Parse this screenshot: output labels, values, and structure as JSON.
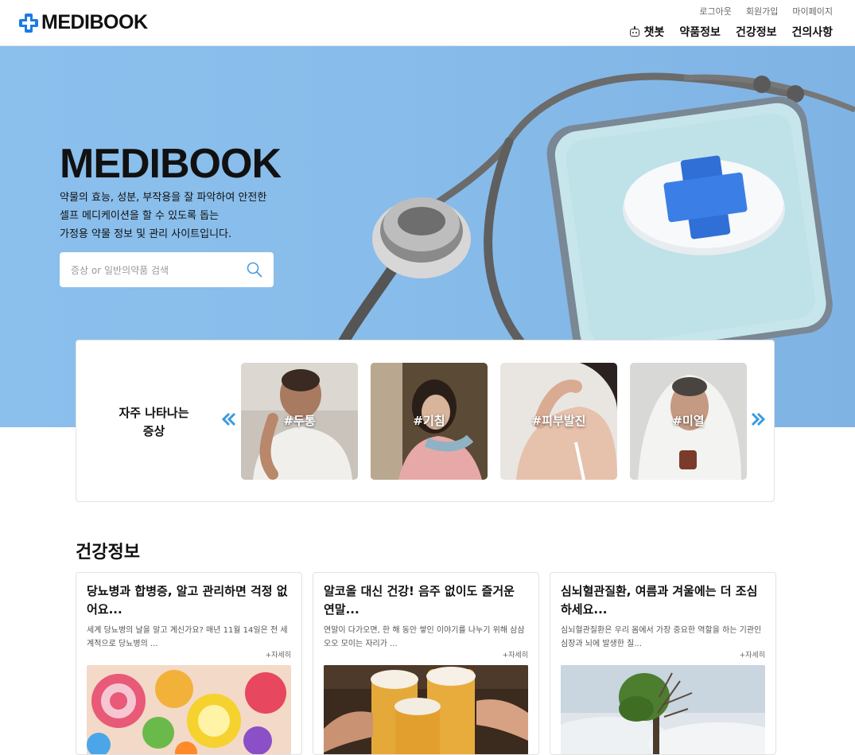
{
  "header": {
    "logo_text": "MEDIBOOK",
    "util_links": [
      "로그아웃",
      "회원가입",
      "마이페이지"
    ],
    "nav": {
      "chatbot": "챗봇",
      "drug_info": "약품정보",
      "health_info": "건강정보",
      "suggestions": "건의사항"
    }
  },
  "hero": {
    "title": "MEDIBOOK",
    "desc_lines": [
      "약물의 효능, 성분, 부작용을 잘 파악하여 안전한",
      "셀프 메디케이션을 할 수 있도록 돕는",
      "가정용 약물 정보 및 관리 사이트입니다."
    ],
    "search_placeholder": "증상 or 일반의약품 검색"
  },
  "symptoms": {
    "title_line1": "자주 나타나는",
    "title_line2": "증상",
    "items": [
      "#두통",
      "#기침",
      "#피부발진",
      "#미열"
    ]
  },
  "health": {
    "section_title": "건강정보",
    "more_label": "+자세히",
    "cards": [
      {
        "title": "당뇨병과 합병증, 알고 관리하면 걱정 없어요...",
        "summary": "세계 당뇨병의 날을 알고 계신가요? 매년 11월 14일은 전 세계적으로 당뇨병의 ..."
      },
      {
        "title": "알코올 대신 건강! 음주 없이도 즐거운 연말...",
        "summary": "연말이 다가오면, 한 해 동안 쌓인 이야기를 나누기 위해 삼삼오오 모이는 자리가 ..."
      },
      {
        "title": "심뇌혈관질환, 여름과 겨울에는 더 조심하세요...",
        "summary": "심뇌혈관질환은 우리 몸에서 가장 중요한 역할을 하는 기관인 심장과 뇌에 발생한 질..."
      }
    ]
  },
  "colors": {
    "brand_blue": "#1a7be6",
    "hero_bg": "#8bbfec",
    "arrow_blue": "#3a9be0"
  }
}
